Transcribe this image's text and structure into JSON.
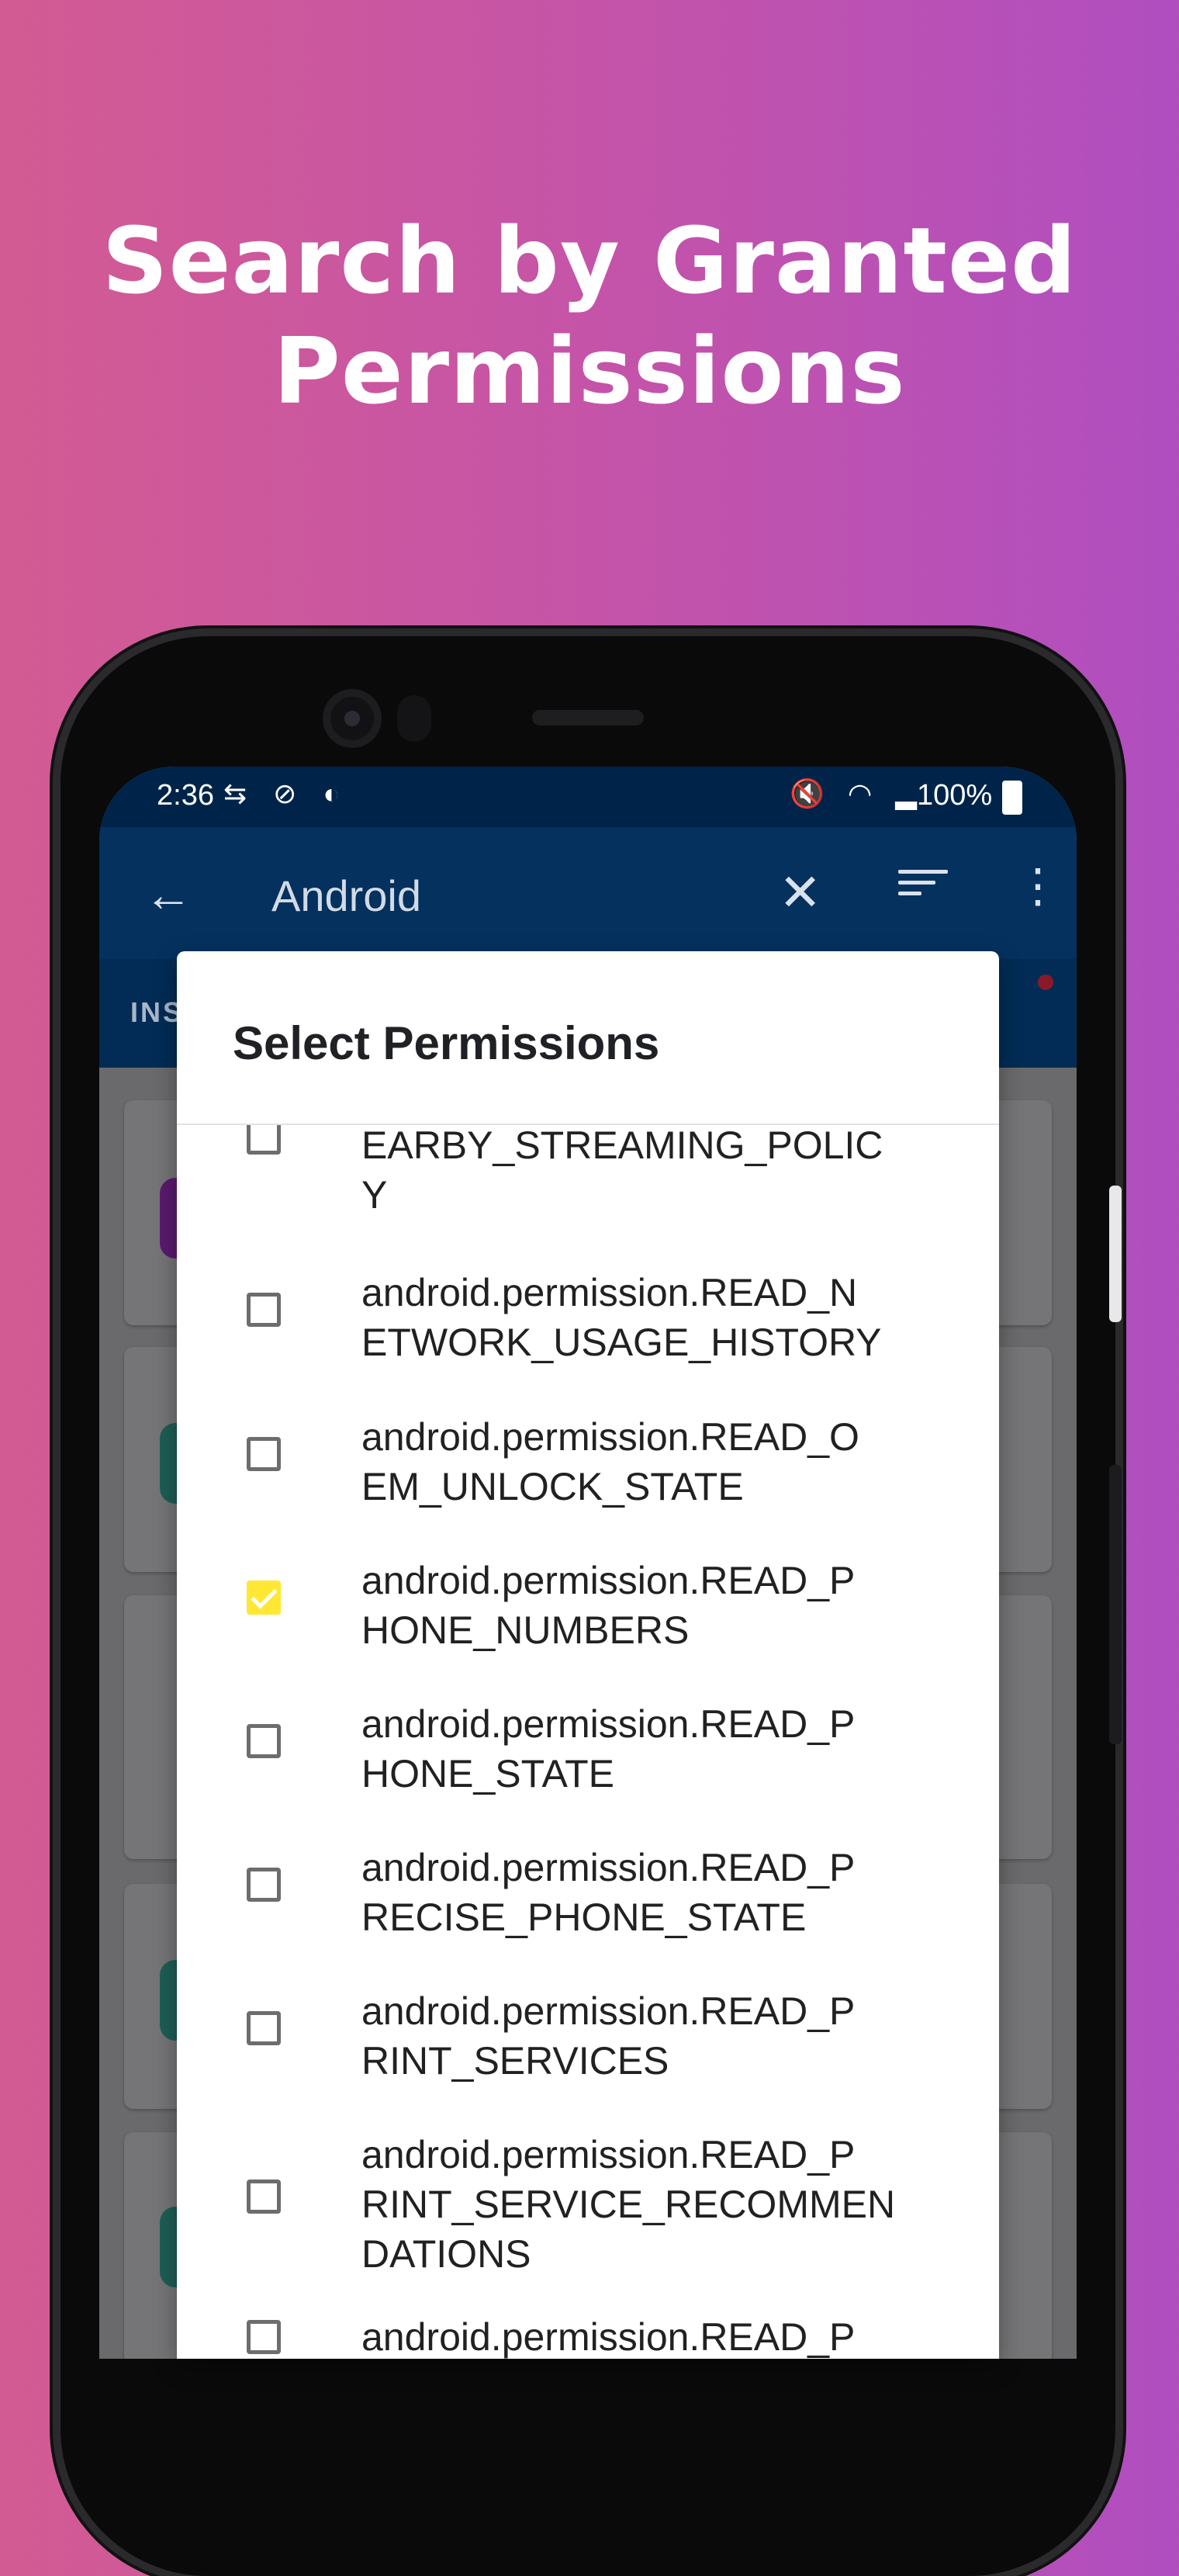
{
  "headline": {
    "line1": "Search by Granted",
    "line2": "Permissions"
  },
  "status_bar": {
    "time": "2:36",
    "left_icons": "⇆ ⊘ ◐",
    "right_icons": "🔇 ◠ ▂",
    "battery": "100%"
  },
  "toolbar": {
    "back_icon": "←",
    "search_query": "Android",
    "clear_icon": "✕",
    "more_icon": "⋮"
  },
  "tabs": {
    "partial_label": "INS"
  },
  "dialog": {
    "title": "Select Permissions",
    "items": [
      {
        "label": "EARBY_STREAMING_POLIC\nY",
        "checked": false
      },
      {
        "label": "android.permission.READ_N\nETWORK_USAGE_HISTORY",
        "checked": false
      },
      {
        "label": "android.permission.READ_O\nEM_UNLOCK_STATE",
        "checked": false
      },
      {
        "label": "android.permission.READ_P\nHONE_NUMBERS",
        "checked": true
      },
      {
        "label": "android.permission.READ_P\nHONE_STATE",
        "checked": false
      },
      {
        "label": "android.permission.READ_P\nRECISE_PHONE_STATE",
        "checked": false
      },
      {
        "label": "android.permission.READ_P\nRINT_SERVICES",
        "checked": false
      },
      {
        "label": "android.permission.READ_P\nRINT_SERVICE_RECOMMEN\nDATIONS",
        "checked": false
      },
      {
        "label": "android.permission.READ_P",
        "checked": false
      }
    ]
  },
  "colors": {
    "status_bar": "#002449",
    "toolbar": "#04315e",
    "checkbox_checked": "#ffe833",
    "checkbox_unchecked": "#6d6d6d"
  }
}
